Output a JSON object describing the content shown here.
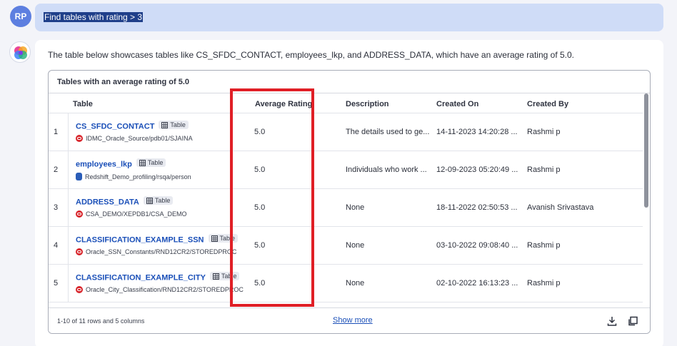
{
  "user": {
    "initials": "RP",
    "query": "Find tables with rating > 3"
  },
  "answer": {
    "text": "The table below showcases tables like CS_SFDC_CONTACT, employees_lkp, and ADDRESS_DATA, which have an average rating of 5.0.",
    "table_title": "Tables with an average rating of 5.0",
    "columns": [
      "Table",
      "Average Rating",
      "Description",
      "Created On",
      "Created By"
    ],
    "rows": [
      {
        "index": "1",
        "name": "CS_SFDC_CONTACT",
        "badge": "Table",
        "source": "oracle",
        "path": "IDMC_Oracle_Source/pdb01/SJAINA",
        "rating": "5.0",
        "description": "The details used to ge...",
        "created_on": "14-11-2023 14:20:28 ...",
        "created_by": "Rashmi p"
      },
      {
        "index": "2",
        "name": "employees_lkp",
        "badge": "Table",
        "source": "redshift",
        "path": "Redshift_Demo_profiling/rsqa/person",
        "rating": "5.0",
        "description": "Individuals who work ...",
        "created_on": "12-09-2023 05:20:49 ...",
        "created_by": "Rashmi p"
      },
      {
        "index": "3",
        "name": "ADDRESS_DATA",
        "badge": "Table",
        "source": "oracle",
        "path": "CSA_DEMO/XEPDB1/CSA_DEMO",
        "rating": "5.0",
        "description": "None",
        "created_on": "18-11-2022 02:50:53 ...",
        "created_by": "Avanish Srivastava"
      },
      {
        "index": "4",
        "name": "CLASSIFICATION_EXAMPLE_SSN",
        "badge": "Table",
        "source": "oracle",
        "path": "Oracle_SSN_Constants/RND12CR2/STOREDPROC",
        "rating": "5.0",
        "description": "None",
        "created_on": "03-10-2022 09:08:40 ...",
        "created_by": "Rashmi p"
      },
      {
        "index": "5",
        "name": "CLASSIFICATION_EXAMPLE_CITY",
        "badge": "Table",
        "source": "oracle",
        "path": "Oracle_City_Classification/RND12CR2/STOREDPROC",
        "rating": "5.0",
        "description": "None",
        "created_on": "02-10-2022 16:13:23 ...",
        "created_by": "Rashmi p"
      }
    ],
    "footer_info": "1-10 of 11 rows and 5 columns",
    "show_more": "Show more"
  },
  "colors": {
    "accent": "#1a4fb8",
    "highlight": "#e01f26",
    "query_bg": "#cfdcf7"
  }
}
